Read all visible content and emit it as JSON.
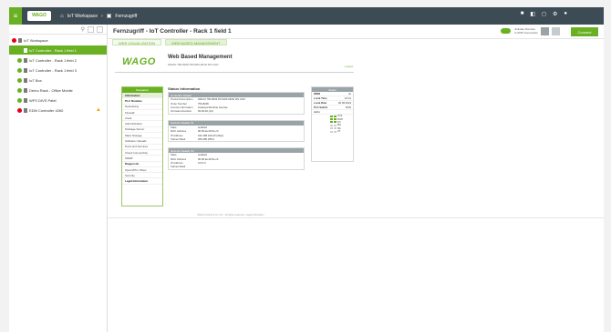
{
  "topbar": {
    "logo_text": "WAGO",
    "breadcrumb_home": "IoT Workspace",
    "breadcrumb_sep": "›",
    "breadcrumb_current": "Fernzugriff"
  },
  "sidebar": {
    "items": [
      {
        "label": "IoT Workspace",
        "status": "red",
        "selected": false,
        "indent": 0
      },
      {
        "label": "IoT Controller - Rack 1 field 1",
        "status": "green",
        "selected": true,
        "indent": 1
      },
      {
        "label": "IoT Controller - Rack 1 field 2",
        "status": "green",
        "selected": false,
        "indent": 1
      },
      {
        "label": "IoT Controller - Rack 1 field 3",
        "status": "green",
        "selected": false,
        "indent": 1
      },
      {
        "label": "IoT Box",
        "status": "green",
        "selected": false,
        "indent": 1
      },
      {
        "label": "Demo Rack - Office Mobile",
        "status": "green",
        "selected": false,
        "indent": 1
      },
      {
        "label": "WFS DIVS Patel",
        "status": "green",
        "selected": false,
        "indent": 1
      },
      {
        "label": "EDM Controller 4260",
        "status": "red",
        "selected": false,
        "indent": 1,
        "warning": true
      }
    ]
  },
  "main": {
    "title": "Fernzugriff - IoT Controller - Rack 1 field 1",
    "toggle_label_1": "Activate 'Remote",
    "toggle_label_2": "to IP/IP Connection",
    "connect_label": "Connect",
    "tabs": [
      {
        "label": "WEB VISUALIZATION",
        "active": false
      },
      {
        "label": "WEB BASED MANAGEMENT",
        "active": true
      }
    ]
  },
  "wbm": {
    "logo": "WAGO",
    "title": "Web Based Management",
    "subtitle": "WAGO 750-8206 PFC200 2ETH RS CAN",
    "logout": "Logout",
    "nav_head": "Navigation",
    "nav_items": [
      {
        "label": "Information",
        "active": true,
        "bold": true
      },
      {
        "label": "PLC Runtime",
        "bold": true
      },
      {
        "label": "Networking"
      },
      {
        "label": "Firewall"
      },
      {
        "label": "Clock"
      },
      {
        "label": "Administration"
      },
      {
        "label": "Package Server"
      },
      {
        "label": "Mass Storage"
      },
      {
        "label": "Software Uploads"
      },
      {
        "label": "Ports and Services"
      },
      {
        "label": "Cloud Connectivity"
      },
      {
        "label": "SNMP"
      },
      {
        "label": "Diagnostic",
        "bold": true
      },
      {
        "label": "OpenVPN / IPsec"
      },
      {
        "label": "Security"
      },
      {
        "label": "Legal Information",
        "bold": true
      }
    ],
    "status_title": "Status Information",
    "controller_box": {
      "head": "Controller Details",
      "rows": [
        {
          "k": "Product Description",
          "v": "WAGO 750-8206 PFC200 2ETH RS CAN"
        },
        {
          "k": "Order Number",
          "v": "750-8206"
        },
        {
          "k": "License Information",
          "v": "Codesys Runtime License"
        },
        {
          "k": "Firmware Revision",
          "v": "03.02.02 (14)"
        }
      ]
    },
    "network_x1": {
      "head": "Network Details X1",
      "rows": [
        {
          "k": "State",
          "v": "enabled"
        },
        {
          "k": "MAC Address",
          "v": "00:30:de:40:5e:c3"
        },
        {
          "k": "IP Address",
          "v": "192.168.100.20 (dhcp)"
        },
        {
          "k": "Subnet Mask",
          "v": "255.255.255.0"
        }
      ]
    },
    "network_x2": {
      "head": "Network Details X2",
      "rows": [
        {
          "k": "State",
          "v": "enabled"
        },
        {
          "k": "MAC Address",
          "v": "00:30:de:40:5e:c4"
        },
        {
          "k": "IP Address",
          "v": "0.0.0.0"
        },
        {
          "k": "Subnet Mask",
          "v": ""
        }
      ]
    },
    "led_box": {
      "head": "Status",
      "rows": [
        {
          "k": "WBM",
          "v": "ok"
        },
        {
          "k": "Local Time",
          "v": "15:41"
        },
        {
          "k": "Local Date",
          "v": "06.08.2024"
        },
        {
          "k": "PLC Switch",
          "v": "RUN"
        }
      ],
      "leds_label": "LEDs",
      "leds": [
        "SYS",
        "RUN",
        "I/O",
        "MS",
        "NS",
        "U7"
      ]
    },
    "footer": "WAGO GmbH & Co. KG - All rights reserved - Legal information"
  },
  "colors": {
    "accent": "#6ab023",
    "topbar": "#3c4b54",
    "error": "#e2001a",
    "warning": "#f4a300"
  }
}
